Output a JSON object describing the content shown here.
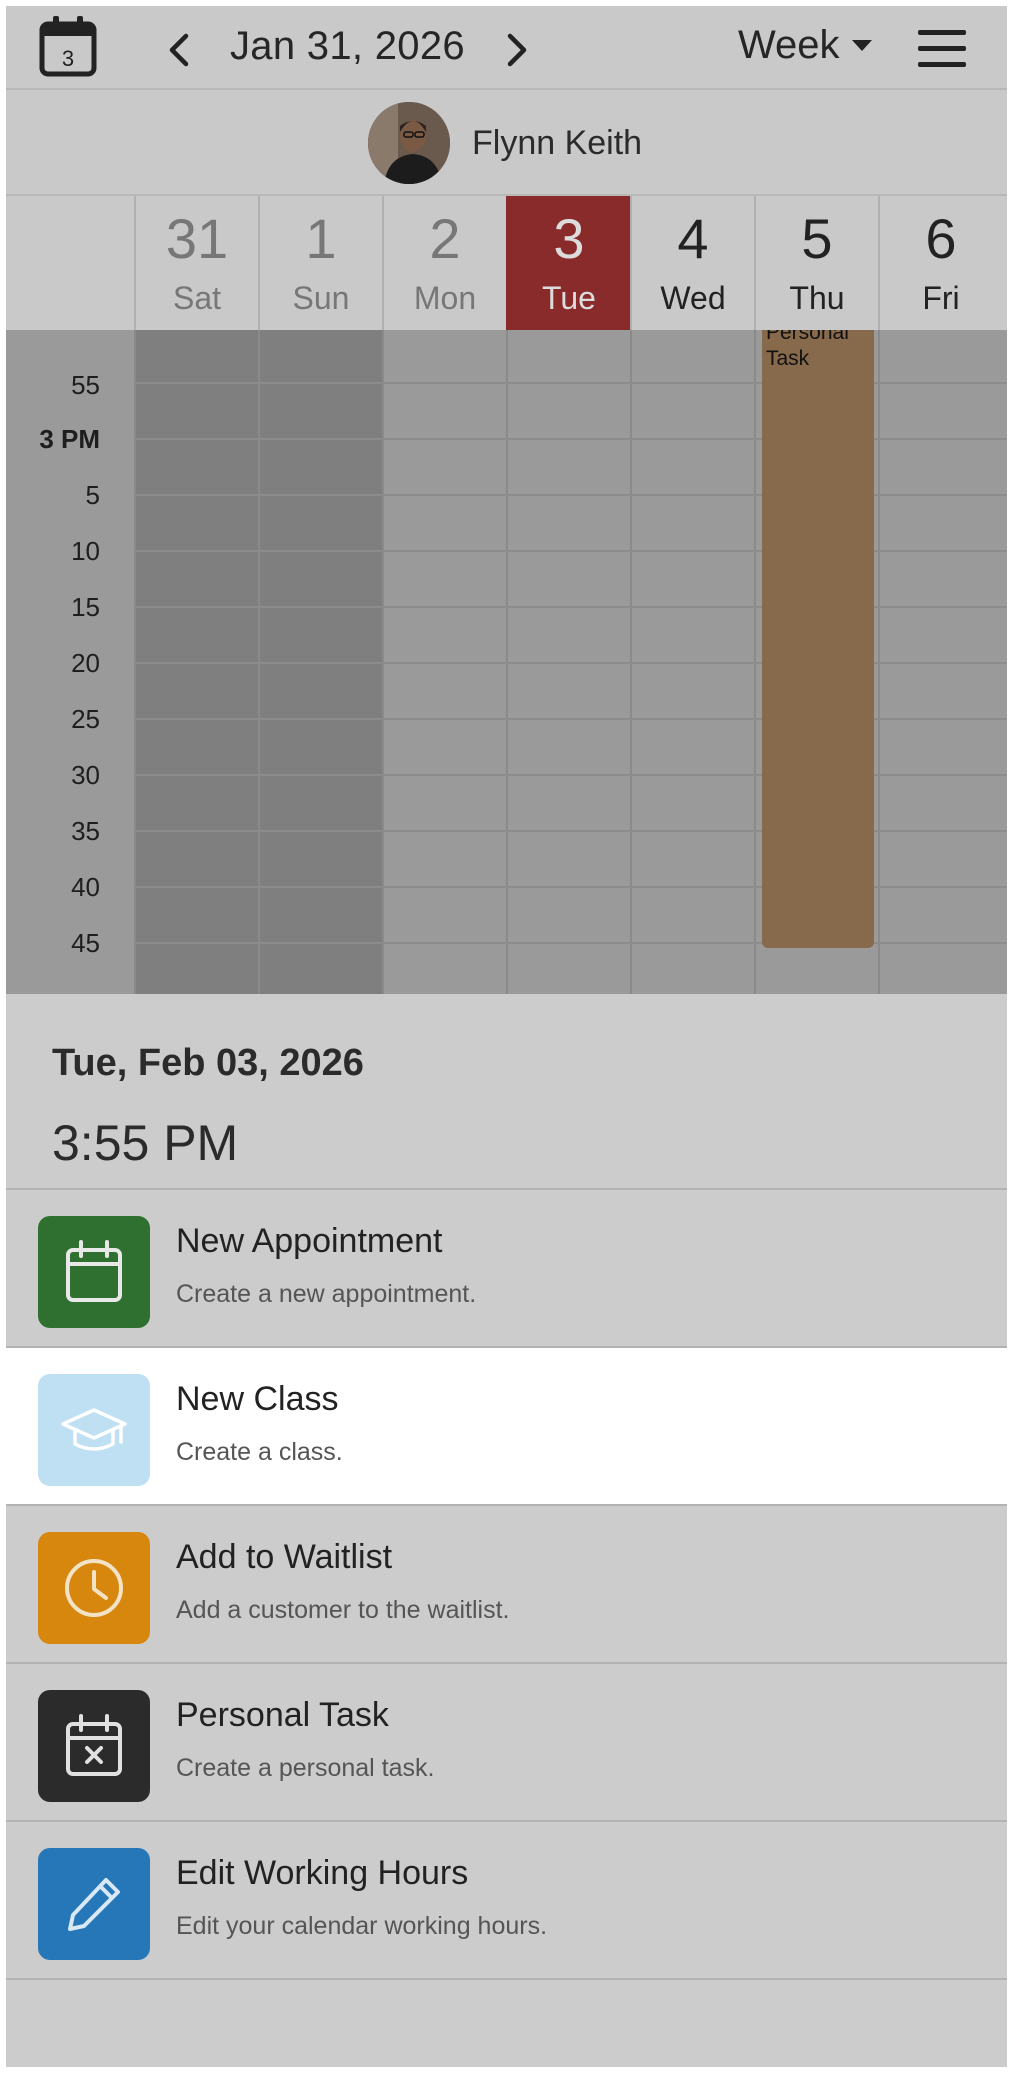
{
  "header": {
    "calendar_badge": "3",
    "date_title": "Jan 31, 2026",
    "view_label": "Week"
  },
  "user": {
    "name": "Flynn Keith"
  },
  "days": [
    {
      "num": "31",
      "name": "Sat"
    },
    {
      "num": "1",
      "name": "Sun"
    },
    {
      "num": "2",
      "name": "Mon"
    },
    {
      "num": "3",
      "name": "Tue"
    },
    {
      "num": "4",
      "name": "Wed"
    },
    {
      "num": "5",
      "name": "Thu"
    },
    {
      "num": "6",
      "name": "Fri"
    }
  ],
  "time_labels": [
    "55",
    "3 PM",
    "5",
    "10",
    "15",
    "20",
    "25",
    "30",
    "35",
    "40",
    "45"
  ],
  "event": {
    "title": "Personal Task"
  },
  "sheet": {
    "date": "Tue, Feb 03, 2026",
    "time": "3:55 PM",
    "actions": [
      {
        "title": "New Appointment",
        "desc": "Create a new appointment.",
        "color": "#2f6f2f",
        "icon": "calendar-icon"
      },
      {
        "title": "New Class",
        "desc": "Create a class.",
        "color": "#bfdff3",
        "icon": "graduation-cap-icon"
      },
      {
        "title": "Add to Waitlist",
        "desc": "Add a customer to the waitlist.",
        "color": "#d7870d",
        "icon": "clock-icon"
      },
      {
        "title": "Personal Task",
        "desc": "Create a personal task.",
        "color": "#2b2b2b",
        "icon": "calendar-x-icon"
      },
      {
        "title": "Edit Working Hours",
        "desc": "Edit your calendar working hours.",
        "color": "#2677b8",
        "icon": "pencil-icon"
      }
    ]
  },
  "colors": {
    "today": "#8a2b2b",
    "event": "#866a4b",
    "selected_row": "#ffffff"
  }
}
